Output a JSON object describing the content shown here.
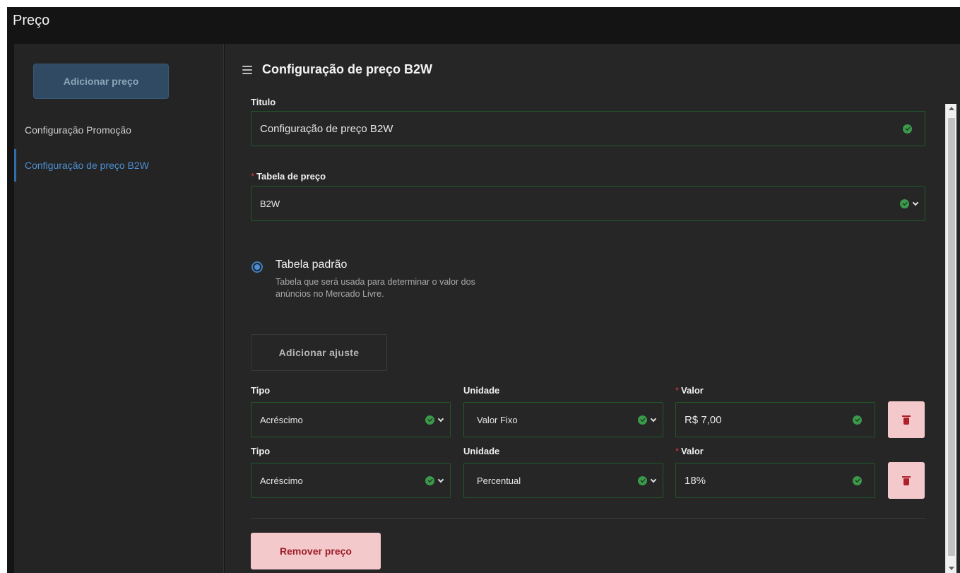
{
  "window": {
    "title": "Preço"
  },
  "sidebar": {
    "add_button": "Adicionar preço",
    "items": [
      {
        "label": "Configuração Promoção",
        "active": false
      },
      {
        "label": "Configuração de preço B2W",
        "active": true
      }
    ]
  },
  "main": {
    "menu_icon": "hamburger-icon",
    "title": "Configuração de preço B2W",
    "titulo": {
      "label": "Titulo",
      "value": "Configuração de preço B2W"
    },
    "tabela": {
      "label": "Tabela de preço",
      "required": true,
      "value": "B2W"
    },
    "default_table": {
      "title": "Tabela padrão",
      "description": "Tabela que será usada para determinar o valor dos anúncios no Mercado Livre.",
      "checked": true
    },
    "add_adjust_button": "Adicionar ajuste",
    "adjustments": [
      {
        "tipo_label": "Tipo",
        "tipo": "Acréscimo",
        "unidade_label": "Unidade",
        "unidade": "Valor Fixo",
        "valor_label": "Valor",
        "valor": "R$ 7,00"
      },
      {
        "tipo_label": "Tipo",
        "tipo": "Acréscimo",
        "unidade_label": "Unidade",
        "unidade": "Percentual",
        "valor_label": "Valor",
        "valor": "18%"
      }
    ],
    "remove_button": "Remover preço"
  },
  "colors": {
    "accent_blue": "#4e8fd0",
    "success_green": "#3a9a4a",
    "danger_bg": "#f4c9cc",
    "danger_text": "#9c1f28",
    "background": "#262626"
  }
}
